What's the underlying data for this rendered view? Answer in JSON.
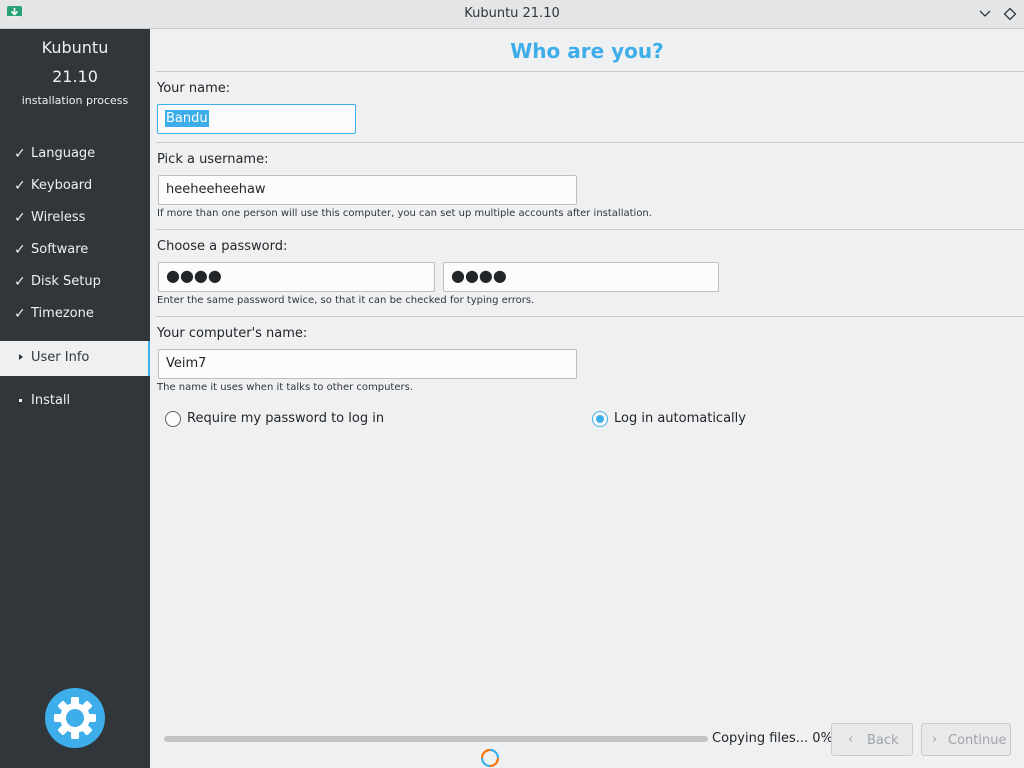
{
  "window": {
    "title": "Kubuntu 21.10",
    "icons": {
      "app": "installer-icon",
      "minimize": "chevron-down-icon",
      "maximize": "diamond-icon"
    }
  },
  "sidebar": {
    "product": "Kubuntu",
    "version": "21.10",
    "subtitle": "installation process",
    "steps": [
      {
        "label": "Language",
        "state": "done",
        "mark": "✓"
      },
      {
        "label": "Keyboard",
        "state": "done",
        "mark": "✓"
      },
      {
        "label": "Wireless",
        "state": "done",
        "mark": "✓"
      },
      {
        "label": "Software",
        "state": "done",
        "mark": "✓"
      },
      {
        "label": "Disk Setup",
        "state": "done",
        "mark": "✓"
      },
      {
        "label": "Timezone",
        "state": "done",
        "mark": "✓"
      },
      {
        "label": "User Info",
        "state": "current"
      },
      {
        "label": "Install",
        "state": "pending"
      }
    ]
  },
  "form": {
    "title": "Who are you?",
    "name_label": "Your name:",
    "name_value": "Bandu",
    "username_label": "Pick a username:",
    "username_value": "heeheeheehaw",
    "username_hint": "If more than one person will use this computer, you can set up multiple accounts after installation.",
    "password_label": "Choose a password:",
    "password_value": "●●●●",
    "password_confirm_value": "●●●●",
    "password_hint": "Enter the same password twice, so that it can be checked for typing errors.",
    "computer_label": "Your computer's name:",
    "computer_value": "Veim7",
    "computer_hint": "The name it uses when it talks to other computers.",
    "login_options": [
      {
        "label": "Require my password to log in",
        "selected": false
      },
      {
        "label": "Log in automatically",
        "selected": true
      }
    ]
  },
  "footer": {
    "progress_text": "Copying files... 0%",
    "progress_percent": 0,
    "back_label": "Back",
    "continue_label": "Continue"
  },
  "colors": {
    "accent": "#3daee9",
    "sidebar_bg": "#31363b",
    "window_bg": "#eff0f1"
  }
}
